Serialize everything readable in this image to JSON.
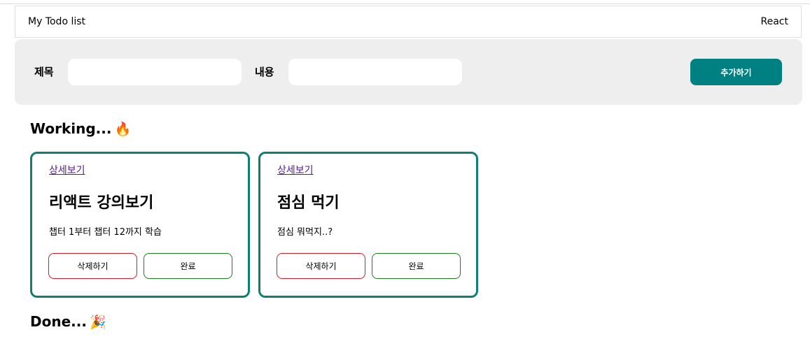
{
  "header": {
    "title": "My Todo list",
    "brand": "React"
  },
  "form": {
    "title_label": "제목",
    "content_label": "내용",
    "title_value": "",
    "content_value": "",
    "add_button_label": "추가하기",
    "accent_color": "#008080"
  },
  "working": {
    "heading": "Working...",
    "emoji": "🔥",
    "todos": [
      {
        "detail_link": "상세보기",
        "title": "리액트 강의보기",
        "body": "챕터 1부터 챕터 12까지 학습",
        "delete_label": "삭제하기",
        "done_label": "완료"
      },
      {
        "detail_link": "상세보기",
        "title": "점심 먹기",
        "body": "점심 뭐먹지..?",
        "delete_label": "삭제하기",
        "done_label": "완료"
      }
    ]
  },
  "done": {
    "heading": "Done...",
    "emoji": "🎉"
  },
  "colors": {
    "card_border": "#0f7f76",
    "delete_border": "#d11a2a",
    "done_border": "#1a7f1a"
  }
}
